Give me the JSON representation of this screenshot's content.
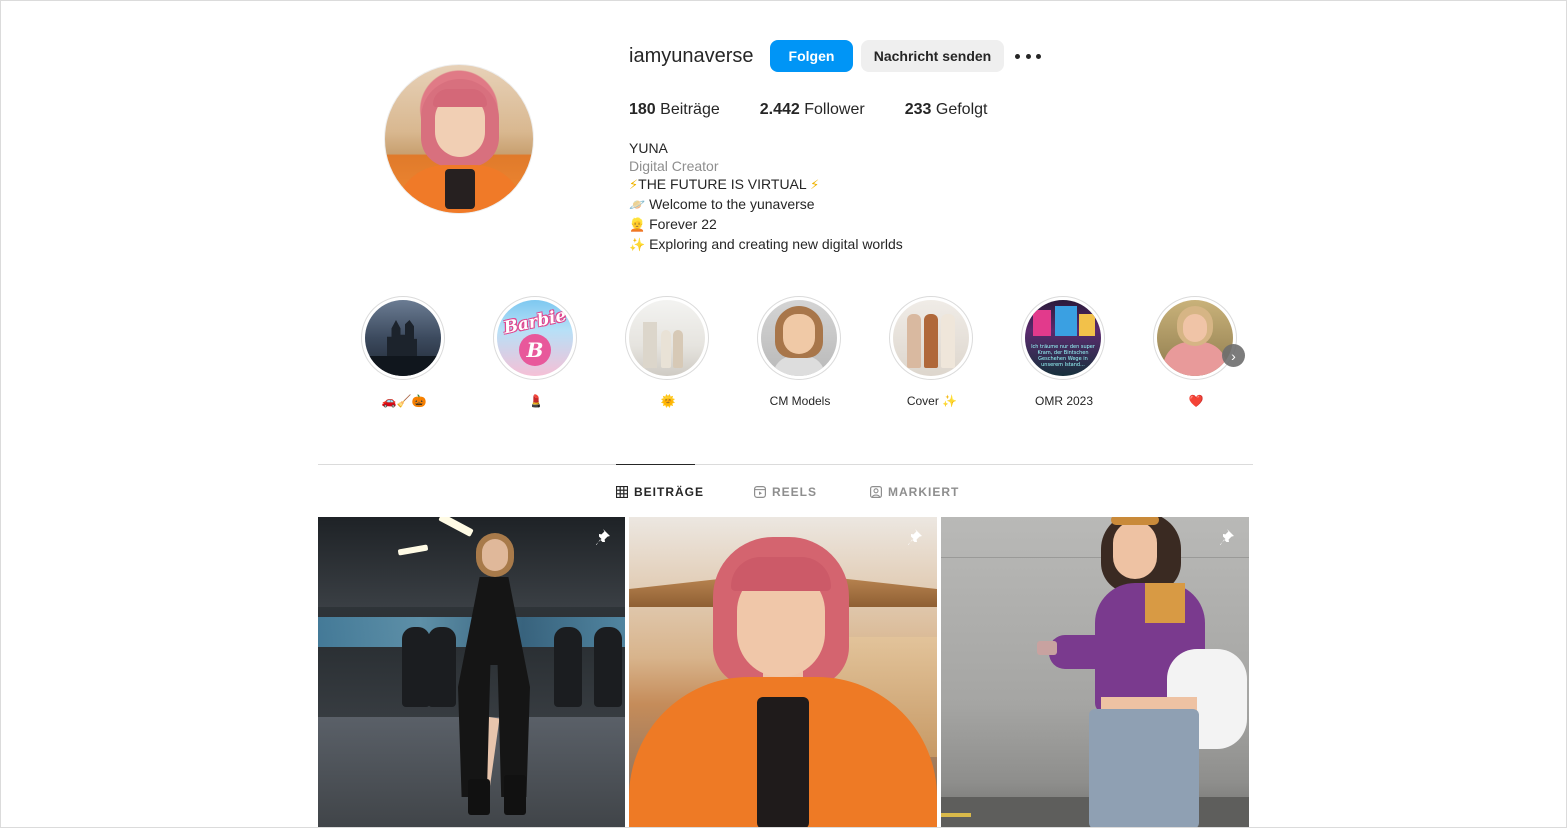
{
  "profile": {
    "username": "iamyunaverse",
    "follow_label": "Folgen",
    "message_label": "Nachricht senden",
    "stats": {
      "posts_count": "180",
      "posts_label": "Beiträge",
      "followers_count": "2.442",
      "followers_label": "Follower",
      "following_count": "233",
      "following_label": "Gefolgt"
    },
    "bio": {
      "name": "YUNA",
      "category": "Digital Creator",
      "line1": "THE FUTURE IS VIRTUAL",
      "line2": "Welcome to the yunaverse",
      "line3": "Forever 22",
      "line4": "Exploring and creating new digital worlds"
    }
  },
  "highlights": [
    {
      "label": "🚗🧹🎃"
    },
    {
      "label": "💄"
    },
    {
      "label": "🌞"
    },
    {
      "label": "CM Models"
    },
    {
      "label": "Cover ✨"
    },
    {
      "label": "OMR 2023"
    },
    {
      "label": "❤️"
    }
  ],
  "highlight_art": {
    "barbie_logo": "Barbie",
    "barbie_b": "B",
    "omr_caption": "Ich träume nur den super Kram, der Bintschen Geschehen Wege in unserem Istand..."
  },
  "tabs": [
    {
      "label": "BEITRÄGE",
      "active": true
    },
    {
      "label": "REELS",
      "active": false
    },
    {
      "label": "MARKIERT",
      "active": false
    }
  ],
  "posts": [
    {
      "pinned": true
    },
    {
      "pinned": true
    },
    {
      "pinned": true
    }
  ],
  "colors": {
    "accent": "#0095f6",
    "secondary_button": "#efefef",
    "text": "#262626",
    "muted": "#8e8e8e",
    "divider": "#dbdbdb"
  },
  "icons": {
    "more": "more-options-icon",
    "pin": "pin-icon",
    "grid": "grid-icon",
    "reels": "reels-icon",
    "tagged": "tagged-icon",
    "next": "chevron-right-icon"
  }
}
